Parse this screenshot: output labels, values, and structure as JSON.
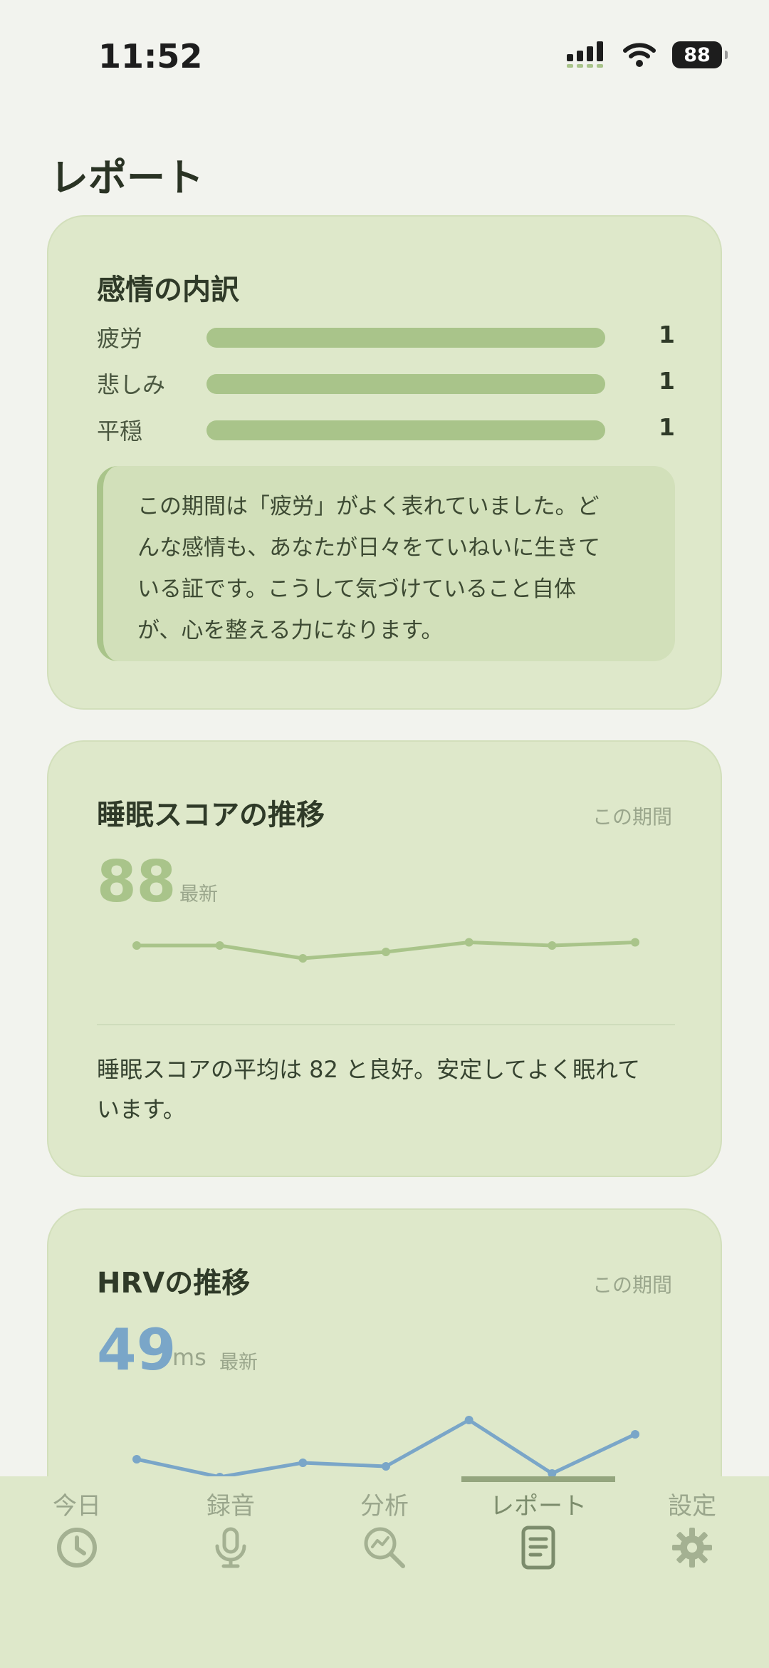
{
  "status": {
    "time": "11:52",
    "battery": "88"
  },
  "page": {
    "title": "レポート"
  },
  "emotion_card": {
    "title": "感情の内訳",
    "rows": [
      {
        "label": "疲労",
        "count": "1",
        "fill": 1.0
      },
      {
        "label": "悲しみ",
        "count": "1",
        "fill": 1.0
      },
      {
        "label": "平穏",
        "count": "1",
        "fill": 1.0
      }
    ],
    "note_lines": [
      "この期間は「疲労」がよく表れていました。ど",
      "んな感情も、あなたが日々をていねいに生きて",
      "いる証です。こうして気づけていること自体",
      "が、心を整える力になります。"
    ]
  },
  "sleep_card": {
    "title": "睡眠スコアの推移",
    "period": "この期間",
    "value": "88",
    "latest_label": "最新",
    "summary_lines": [
      "睡眠スコアの平均は 82 と良好。安定してよく眠れて",
      "います。"
    ]
  },
  "hrv_card": {
    "title": "HRVの推移",
    "period": "この期間",
    "value": "49",
    "unit": "ms",
    "latest_label": "最新"
  },
  "chart_data": [
    {
      "type": "line",
      "series": [
        {
          "values": [
            87,
            87,
            83,
            85,
            88,
            87,
            88
          ]
        }
      ],
      "ylim": [
        75,
        95
      ],
      "color": "#a9c48a"
    },
    {
      "type": "line",
      "series": [
        {
          "values": [
            42,
            37,
            41,
            40,
            53,
            38,
            49
          ]
        }
      ],
      "ylim": [
        30,
        60
      ],
      "color": "#7aa6c8"
    }
  ],
  "tabs": [
    {
      "label": "今日",
      "icon": "clock-icon"
    },
    {
      "label": "録音",
      "icon": "microphone-icon"
    },
    {
      "label": "分析",
      "icon": "analysis-magnifier-icon"
    },
    {
      "label": "レポート",
      "icon": "report-document-icon",
      "active": true
    },
    {
      "label": "設定",
      "icon": "gear-icon"
    }
  ],
  "colors": {
    "accent_green": "#a9c48a",
    "hrv_blue": "#7aa6c8",
    "card": "#dee8ca",
    "background": "#f2f3ee"
  }
}
